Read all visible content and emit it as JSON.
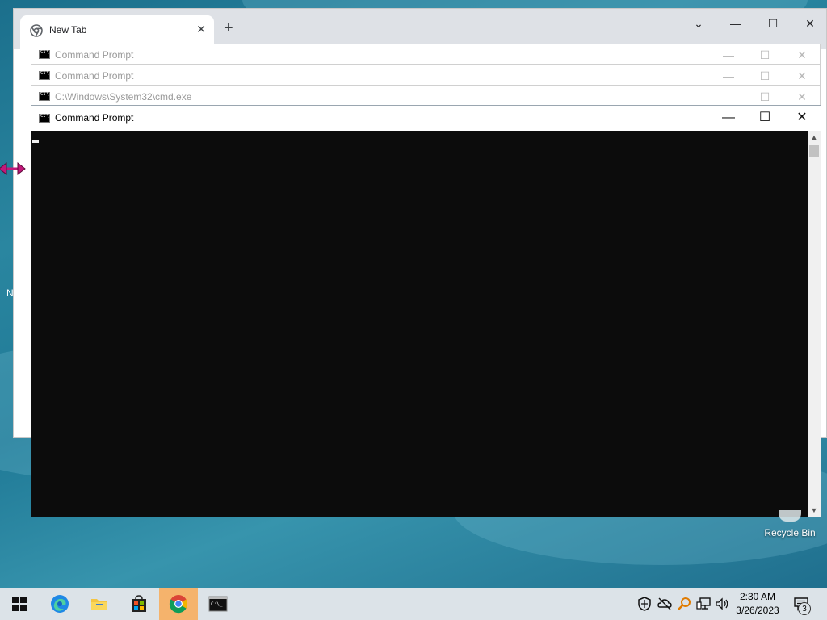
{
  "chrome": {
    "tab_title": "New Tab",
    "close_glyph": "✕",
    "newtab_glyph": "+",
    "controls": {
      "dropdown": "⌄",
      "minimize": "—",
      "maximize": "☐",
      "close": "✕"
    }
  },
  "cmd_windows": [
    {
      "title": "Command Prompt",
      "state": "inactive"
    },
    {
      "title": "Command Prompt",
      "state": "inactive"
    },
    {
      "title": "C:\\Windows\\System32\\cmd.exe",
      "state": "inactive"
    },
    {
      "title": "Command Prompt",
      "state": "active"
    }
  ],
  "window_controls": {
    "minimize": "—",
    "maximize": "☐",
    "close": "✕"
  },
  "desktop": {
    "recycle_bin_label": "Recycle Bin",
    "left_fragment": "N"
  },
  "taskbar": {
    "apps": [
      {
        "name": "start",
        "icon": "windows-logo-icon"
      },
      {
        "name": "edge",
        "icon": "edge-icon"
      },
      {
        "name": "file-explorer",
        "icon": "folder-icon"
      },
      {
        "name": "microsoft-store",
        "icon": "store-icon"
      },
      {
        "name": "chrome",
        "icon": "chrome-icon",
        "active": true
      },
      {
        "name": "command-prompt",
        "icon": "cmd-icon"
      }
    ],
    "tray": {
      "time": "2:30 AM",
      "date": "3/26/2023",
      "notification_count": "3"
    }
  },
  "colors": {
    "taskbar_bg": "#dce3e8",
    "active_app_highlight": "#f5b36c",
    "console_bg": "#0c0c0c",
    "resize_arrow": "#c2187a"
  }
}
